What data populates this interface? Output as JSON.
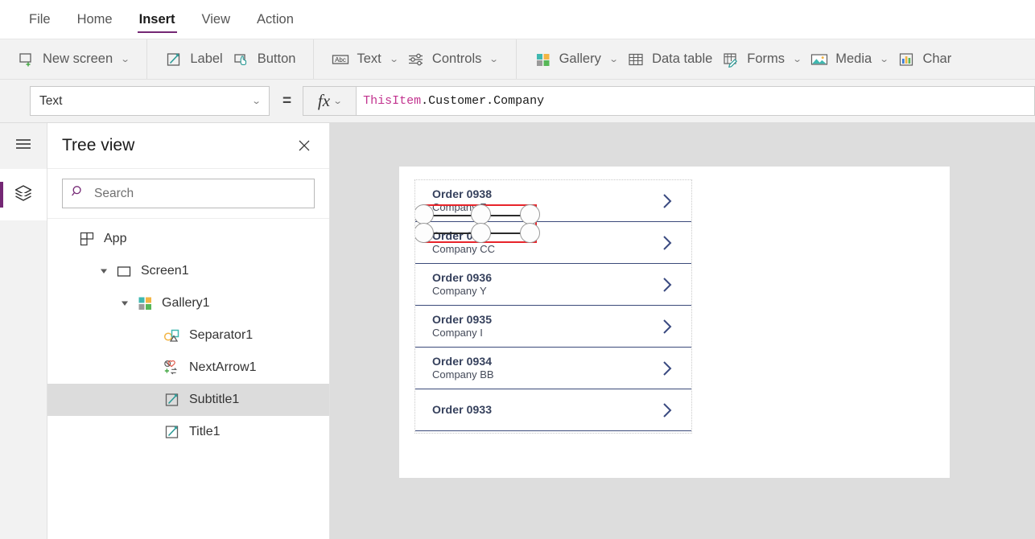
{
  "menu": {
    "tabs": [
      {
        "label": "File",
        "active": false
      },
      {
        "label": "Home",
        "active": false
      },
      {
        "label": "Insert",
        "active": true
      },
      {
        "label": "View",
        "active": false
      },
      {
        "label": "Action",
        "active": false
      }
    ]
  },
  "ribbon": {
    "groups": [
      {
        "items": [
          {
            "label": "New screen",
            "icon": "new-screen-icon",
            "caret": true
          }
        ]
      },
      {
        "items": [
          {
            "label": "Label",
            "icon": "label-icon",
            "caret": false
          },
          {
            "label": "Button",
            "icon": "button-icon",
            "caret": false
          }
        ]
      },
      {
        "items": [
          {
            "label": "Text",
            "icon": "text-icon",
            "caret": true
          },
          {
            "label": "Controls",
            "icon": "controls-icon",
            "caret": true
          }
        ]
      },
      {
        "items": [
          {
            "label": "Gallery",
            "icon": "gallery-icon",
            "caret": true
          },
          {
            "label": "Data table",
            "icon": "data-table-icon",
            "caret": false
          },
          {
            "label": "Forms",
            "icon": "forms-icon",
            "caret": true
          },
          {
            "label": "Media",
            "icon": "media-icon",
            "caret": true
          },
          {
            "label": "Char",
            "icon": "charts-icon",
            "caret": false
          }
        ]
      }
    ]
  },
  "formula": {
    "property": "Text",
    "equals": "=",
    "fx_label": "fx",
    "value_prefix": "ThisItem",
    "value_rest": ".Customer.Company"
  },
  "rail": {
    "menu_icon": "hamburger-menu-icon",
    "tree_icon": "layers-icon"
  },
  "treeview": {
    "title": "Tree view",
    "close_label": "×",
    "search_placeholder": "Search",
    "search_value": "",
    "items": [
      {
        "label": "App",
        "icon": "app-icon",
        "indent": 0,
        "twisty": "",
        "selected": false
      },
      {
        "label": "Screen1",
        "icon": "screen-icon",
        "indent": 0,
        "twisty": "▾",
        "selected": false
      },
      {
        "label": "Gallery1",
        "icon": "gallery-icon",
        "indent": 1,
        "twisty": "▾",
        "selected": false
      },
      {
        "label": "Separator1",
        "icon": "separator-icon",
        "indent": 2,
        "twisty": "",
        "selected": false
      },
      {
        "label": "NextArrow1",
        "icon": "nextarrow-icon",
        "indent": 2,
        "twisty": "",
        "selected": false
      },
      {
        "label": "Subtitle1",
        "icon": "label-edit-icon",
        "indent": 2,
        "twisty": "",
        "selected": true
      },
      {
        "label": "Title1",
        "icon": "label-edit-icon",
        "indent": 2,
        "twisty": "",
        "selected": false
      }
    ]
  },
  "canvas": {
    "gallery_items": [
      {
        "title": "Order 0938",
        "subtitle": "Company F",
        "selected": true
      },
      {
        "title": "Order 0937",
        "subtitle": "Company CC",
        "selected": false
      },
      {
        "title": "Order 0936",
        "subtitle": "Company Y",
        "selected": false
      },
      {
        "title": "Order 0935",
        "subtitle": "Company I",
        "selected": false
      },
      {
        "title": "Order 0934",
        "subtitle": "Company BB",
        "selected": false
      },
      {
        "title": "Order 0933",
        "subtitle": "",
        "selected": false
      }
    ]
  },
  "colors": {
    "accent_purple": "#742774",
    "selection_red": "#e8242a",
    "gallery_navy": "#35405c",
    "formula_token": "#c2338f",
    "canvas_gray": "#dddddd"
  }
}
